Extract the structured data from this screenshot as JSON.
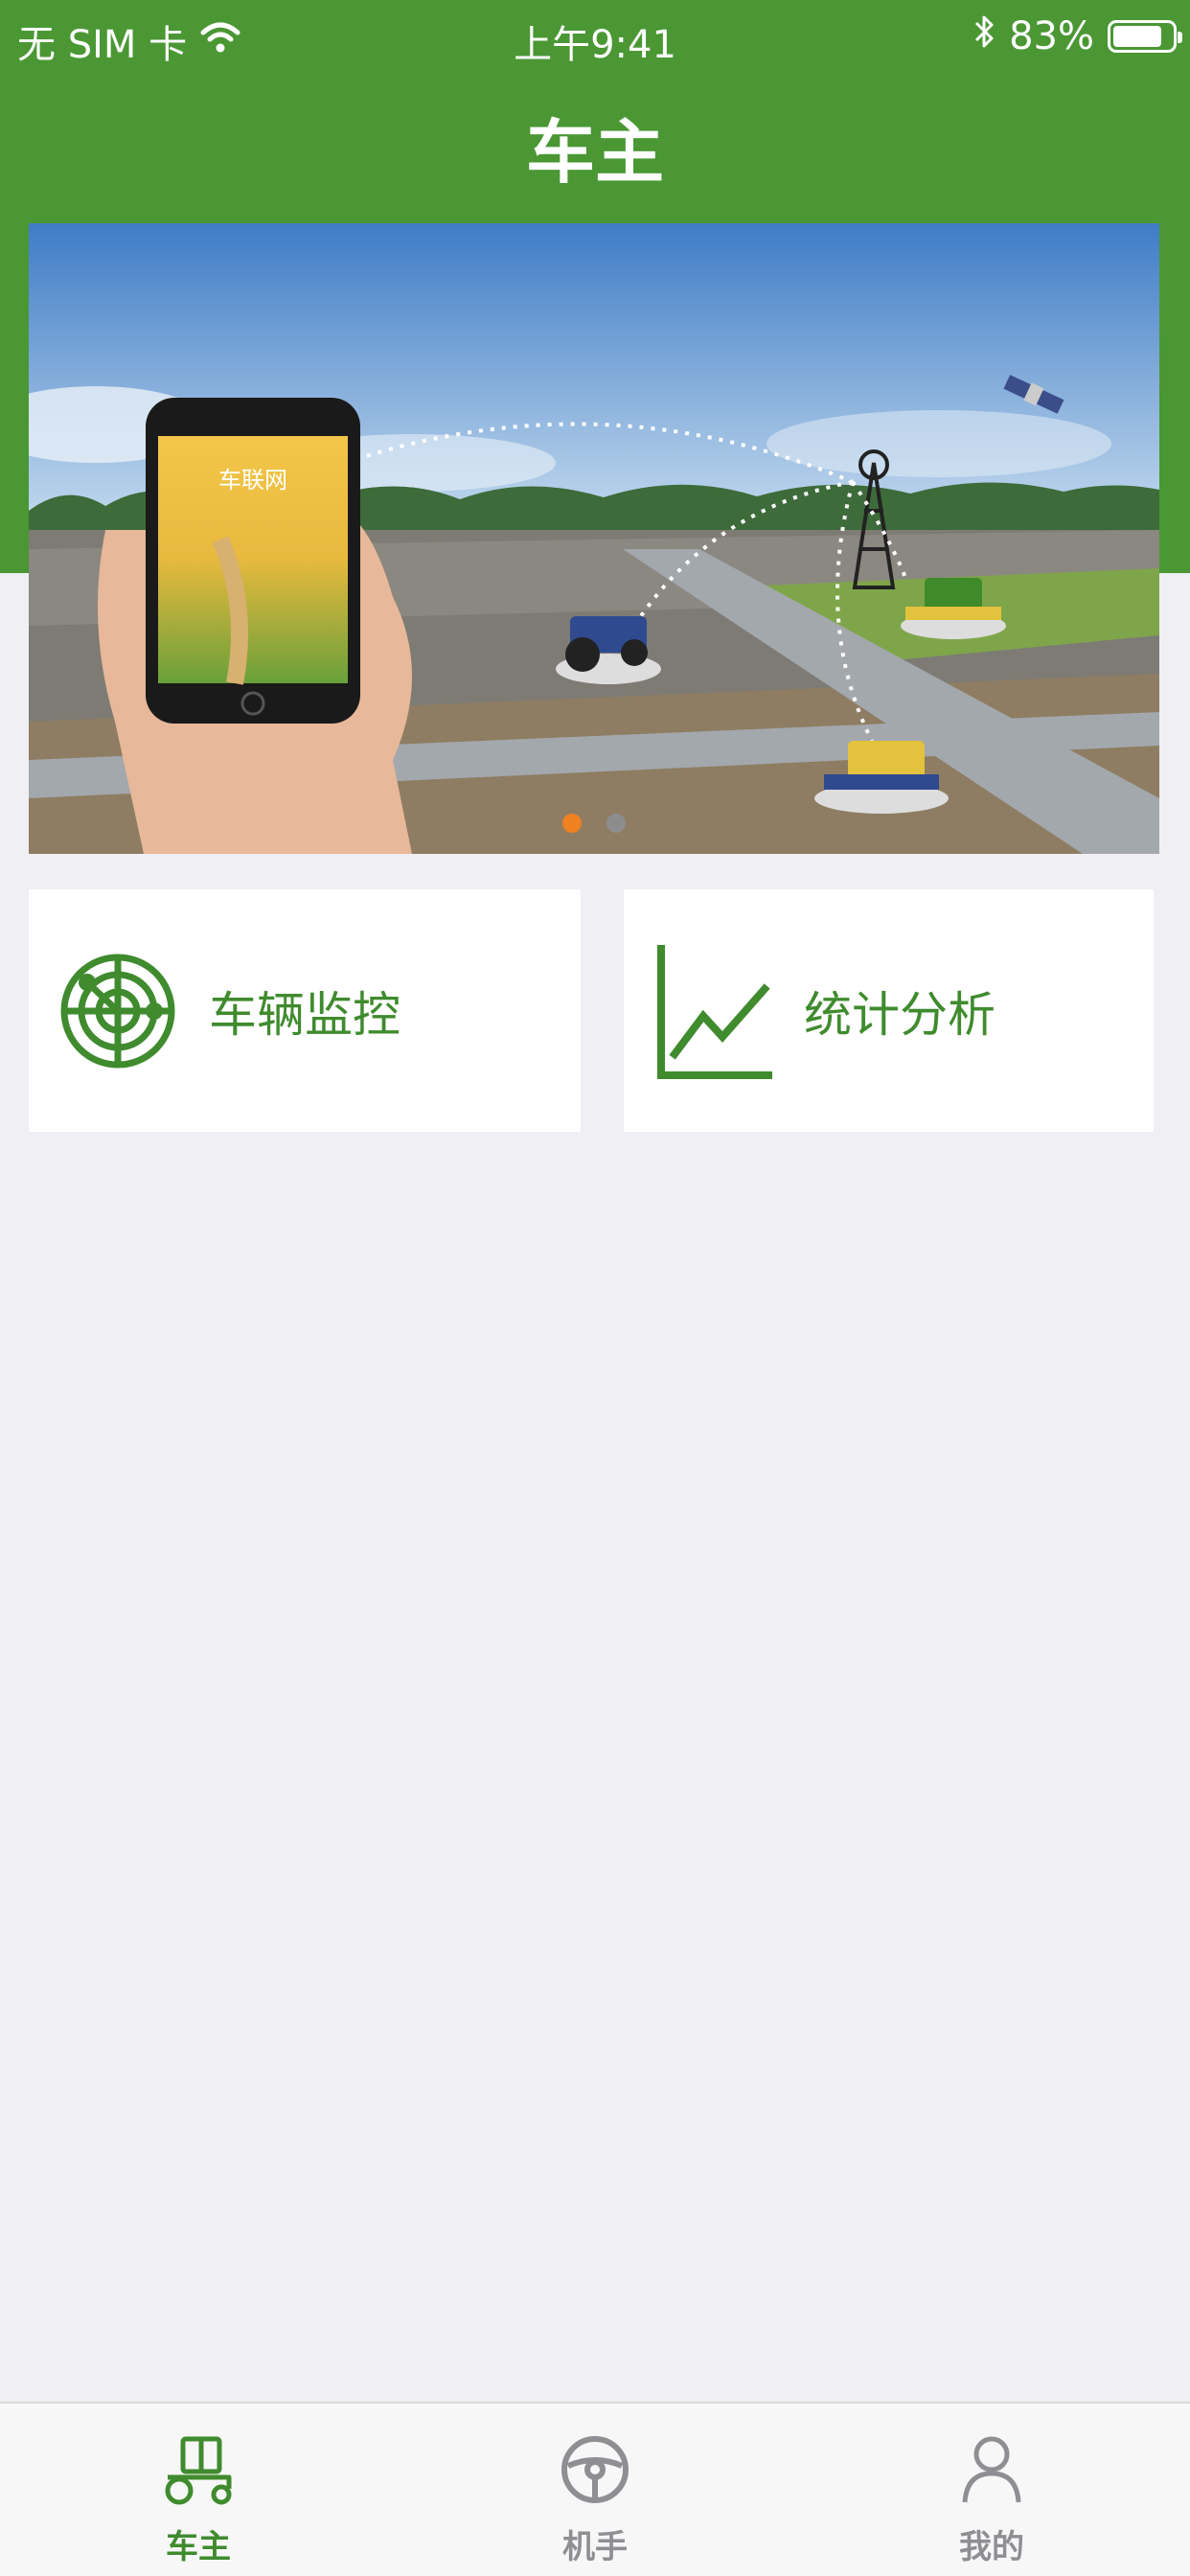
{
  "status_bar": {
    "carrier": "无 SIM 卡",
    "time": "上午9:41",
    "battery_percent": "83%"
  },
  "nav": {
    "title": "车主"
  },
  "banner": {
    "phone_screen_title": "车联网",
    "slides": 2,
    "active_slide": 1
  },
  "cards": [
    {
      "label": "车辆监控",
      "icon": "radar-icon"
    },
    {
      "label": "统计分析",
      "icon": "line-chart-icon"
    }
  ],
  "tabbar": {
    "tabs": [
      {
        "label": "车主",
        "icon": "tractor-icon",
        "active": true
      },
      {
        "label": "机手",
        "icon": "steering-wheel-icon",
        "active": false
      },
      {
        "label": "我的",
        "icon": "person-icon",
        "active": false
      }
    ]
  },
  "colors": {
    "brand_green": "#4a9734",
    "text_green": "#3f8b2e",
    "dot_active": "#f08020"
  }
}
